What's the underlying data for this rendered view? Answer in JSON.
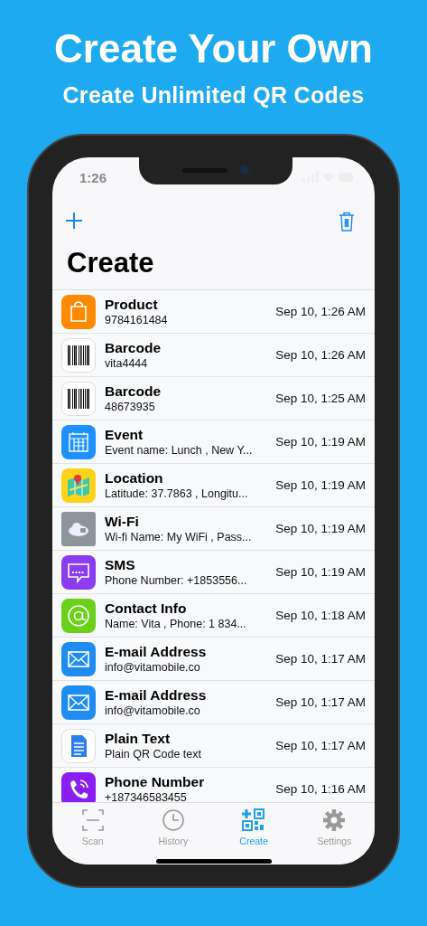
{
  "headline": "Create Your Own",
  "subheadline": "Create Unlimited QR Codes",
  "status_bar": {
    "time": "1:26"
  },
  "title": "Create",
  "items": [
    {
      "kind": "bag",
      "title": "Product",
      "subtitle": "9784161484",
      "date": "Sep 10, 1:26 AM"
    },
    {
      "kind": "barcode",
      "title": "Barcode",
      "subtitle": "vita4444",
      "date": "Sep 10, 1:26 AM"
    },
    {
      "kind": "barcode",
      "title": "Barcode",
      "subtitle": "48673935",
      "date": "Sep 10, 1:25 AM"
    },
    {
      "kind": "calendar",
      "title": "Event",
      "subtitle": "Event name: Lunch , New Y...",
      "date": "Sep 10, 1:19 AM"
    },
    {
      "kind": "map",
      "title": "Location",
      "subtitle": "Latitude: 37.7863 , Longitu...",
      "date": "Sep 10, 1:19 AM"
    },
    {
      "kind": "wifi",
      "title": "Wi-Fi",
      "subtitle": "Wi-fi Name: My WiFi  , Pass...",
      "date": "Sep 10, 1:19 AM"
    },
    {
      "kind": "sms",
      "title": "SMS",
      "subtitle": "Phone Number: +1853556...",
      "date": "Sep 10, 1:19 AM"
    },
    {
      "kind": "at",
      "title": "Contact Info",
      "subtitle": "Name: Vita , Phone: 1 834...",
      "date": "Sep 10, 1:18 AM"
    },
    {
      "kind": "mail",
      "title": "E-mail Address",
      "subtitle": "info@vitamobile.co",
      "date": "Sep 10, 1:17 AM"
    },
    {
      "kind": "mail",
      "title": "E-mail Address",
      "subtitle": "info@vitamobile.co",
      "date": "Sep 10, 1:17 AM"
    },
    {
      "kind": "doc",
      "title": "Plain Text",
      "subtitle": "Plain QR Code text",
      "date": "Sep 10, 1:17 AM"
    },
    {
      "kind": "phone",
      "title": "Phone Number",
      "subtitle": "+187346583455",
      "date": "Sep 10, 1:16 AM"
    }
  ],
  "tabs": [
    {
      "kind": "scan",
      "label": "Scan",
      "selected": false
    },
    {
      "kind": "history",
      "label": "History",
      "selected": false
    },
    {
      "kind": "create",
      "label": "Create",
      "selected": true
    },
    {
      "kind": "settings",
      "label": "Settings",
      "selected": false
    }
  ]
}
